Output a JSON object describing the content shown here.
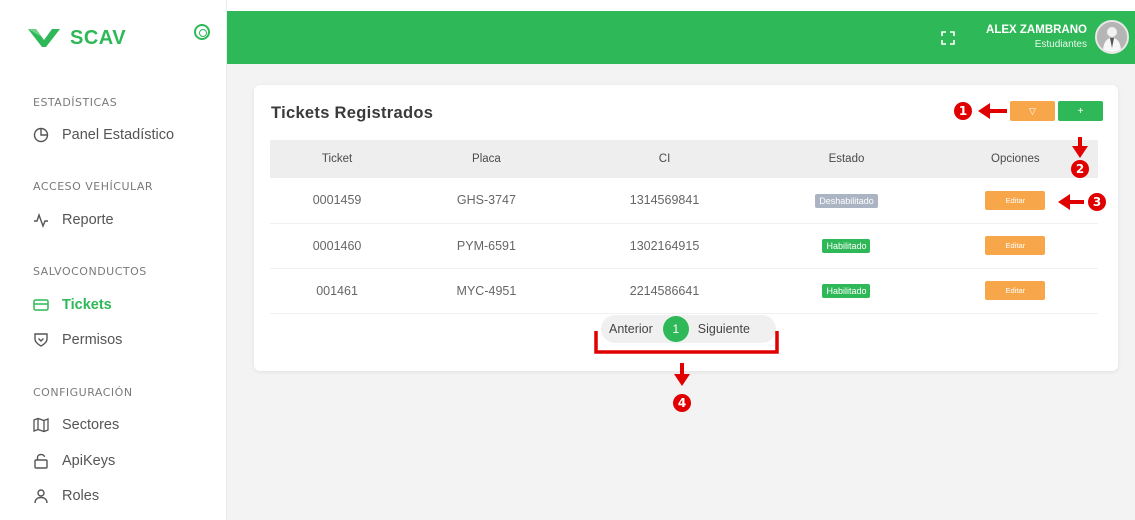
{
  "brand": {
    "name": "SCAV"
  },
  "sidebar": {
    "sections": [
      {
        "title": "ESTADÍSTICAS",
        "items": [
          {
            "label": "Panel Estadístico",
            "icon": "pie-chart-icon"
          }
        ]
      },
      {
        "title": "ACCESO VEHÍCULAR",
        "items": [
          {
            "label": "Reporte",
            "icon": "activity-icon"
          }
        ]
      },
      {
        "title": "SALVOCONDUCTOS",
        "items": [
          {
            "label": "Tickets",
            "icon": "credit-card-icon",
            "active": true
          },
          {
            "label": "Permisos",
            "icon": "shield-icon"
          }
        ]
      },
      {
        "title": "CONFIGURACIÓN",
        "items": [
          {
            "label": "Sectores",
            "icon": "map-icon"
          },
          {
            "label": "ApiKeys",
            "icon": "lock-icon"
          },
          {
            "label": "Roles",
            "icon": "user-icon"
          }
        ]
      }
    ]
  },
  "header": {
    "user_name": "ALEX ZAMBRANO",
    "user_role": "Estudiantes"
  },
  "main": {
    "title": "Tickets Registrados",
    "filter_label": "▽",
    "add_label": "+",
    "columns": [
      "Ticket",
      "Placa",
      "CI",
      "Estado",
      "Opciones"
    ],
    "rows": [
      {
        "ticket": "0001459",
        "placa": "GHS-3747",
        "ci": "1314569841",
        "estado": "Deshabilitado",
        "status": "off",
        "action": "Editar"
      },
      {
        "ticket": "0001460",
        "placa": "PYM-6591",
        "ci": "1302164915",
        "estado": "Habilitado",
        "status": "on",
        "action": "Editar"
      },
      {
        "ticket": "001461",
        "placa": "MYC-4951",
        "ci": "2214586641",
        "estado": "Habilitado",
        "status": "on",
        "action": "Editar"
      }
    ],
    "pagination": {
      "prev": "Anterior",
      "current": "1",
      "next": "Siguiente"
    }
  },
  "annotations": {
    "m1": "1",
    "m2": "2",
    "m3": "3",
    "m4": "4"
  },
  "colors": {
    "primary": "#2fb857",
    "warning": "#f7a74a",
    "disabled": "#aab4c2",
    "annotation": "#e00000"
  }
}
